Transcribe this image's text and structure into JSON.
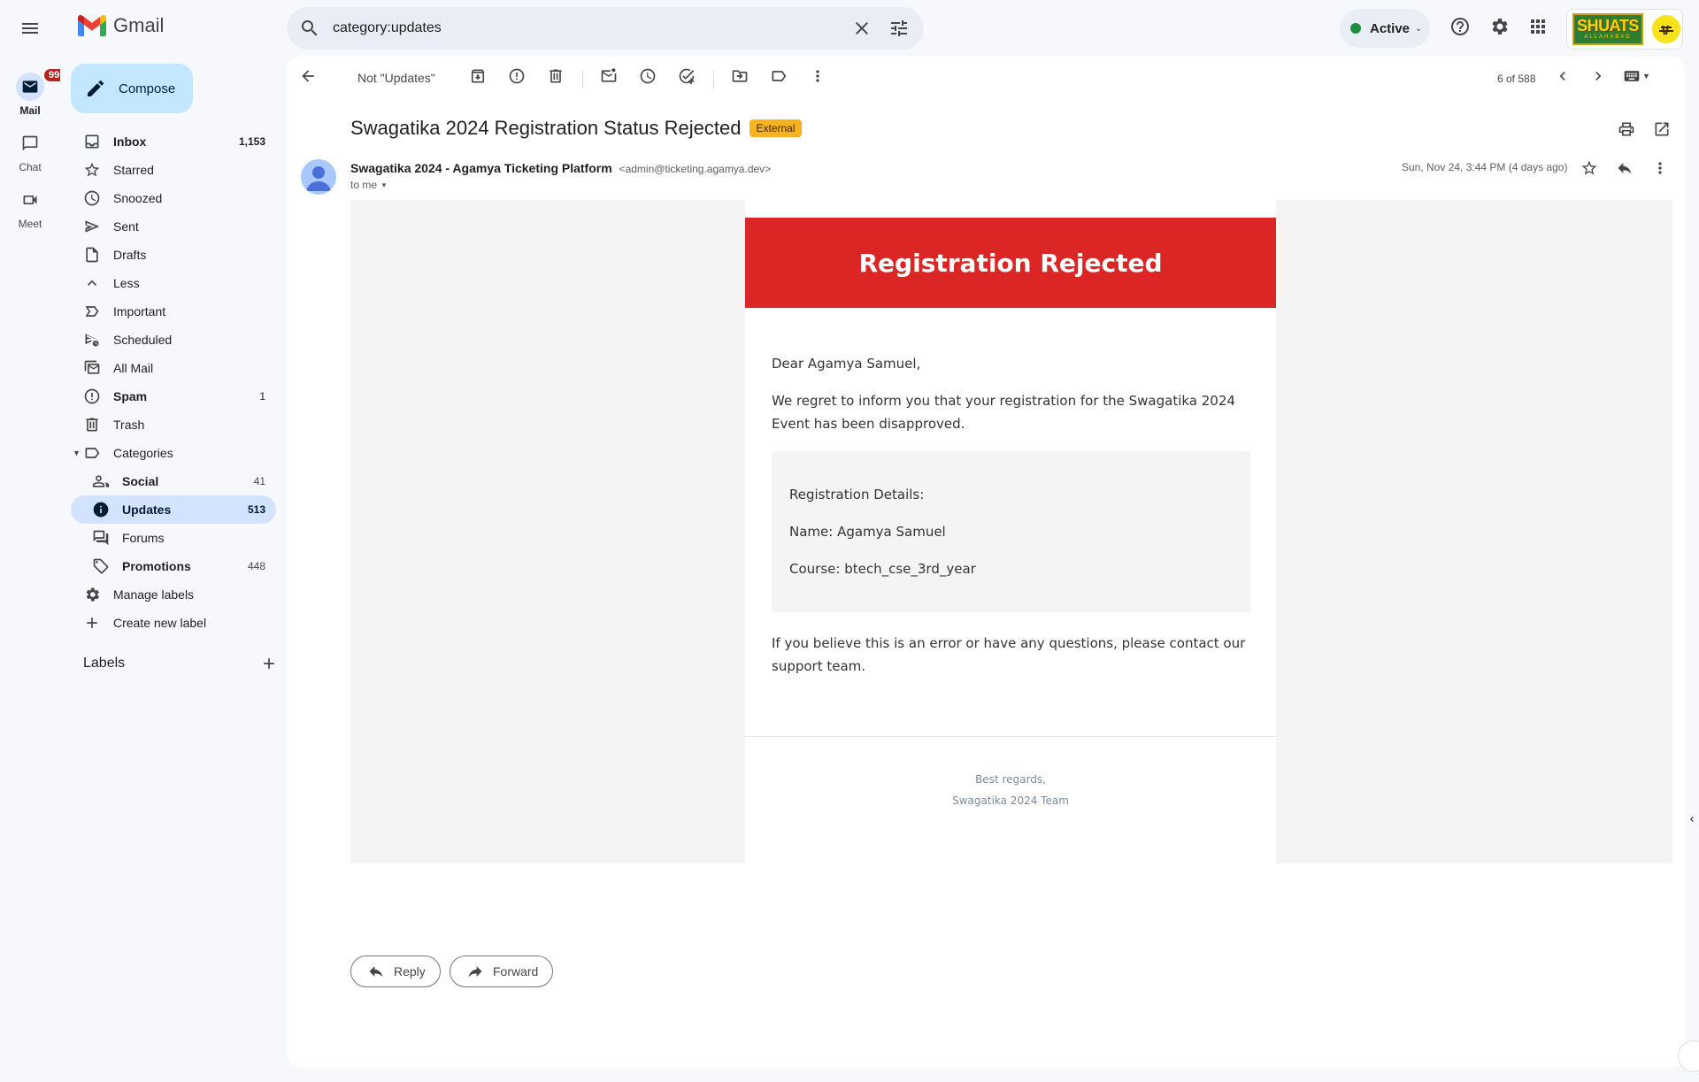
{
  "app": {
    "name": "Gmail"
  },
  "search": {
    "query": "category:updates"
  },
  "status": {
    "label": "Active",
    "color": "#1e8e3e"
  },
  "account": {
    "org_logo_text": "SHUATS",
    "org_logo_subtext": "ALLAHABAD"
  },
  "rail": {
    "items": [
      {
        "label": "Mail",
        "badge": "99+"
      },
      {
        "label": "Chat"
      },
      {
        "label": "Meet"
      }
    ]
  },
  "sidebar": {
    "compose_label": "Compose",
    "items": [
      {
        "label": "Inbox",
        "count": "1,153"
      },
      {
        "label": "Starred",
        "count": ""
      },
      {
        "label": "Snoozed",
        "count": ""
      },
      {
        "label": "Sent",
        "count": ""
      },
      {
        "label": "Drafts",
        "count": ""
      },
      {
        "label": "Less",
        "count": ""
      },
      {
        "label": "Important",
        "count": ""
      },
      {
        "label": "Scheduled",
        "count": ""
      },
      {
        "label": "All Mail",
        "count": ""
      },
      {
        "label": "Spam",
        "count": "1"
      },
      {
        "label": "Trash",
        "count": ""
      },
      {
        "label": "Categories",
        "count": ""
      }
    ],
    "categories": [
      {
        "label": "Social",
        "count": "41"
      },
      {
        "label": "Updates",
        "count": "513"
      },
      {
        "label": "Forums",
        "count": ""
      },
      {
        "label": "Promotions",
        "count": "448"
      }
    ],
    "manage_labels": "Manage labels",
    "create_label": "Create new label",
    "labels_heading": "Labels"
  },
  "toolbar": {
    "not_updates": "Not \"Updates\"",
    "pager": "6 of 588"
  },
  "message": {
    "subject": "Swagatika 2024 Registration Status Rejected",
    "external_badge": "External",
    "sender_name": "Swagatika 2024 - Agamya Ticketing Platform",
    "sender_email": "<admin@ticketing.agamya.dev>",
    "to": "to me",
    "date": "Sun, Nov 24, 3:44 PM (4 days ago)"
  },
  "email": {
    "banner": "Registration Rejected",
    "greeting": "Dear Agamya Samuel,",
    "paragraph1": "We regret to inform you that your registration for the Swagatika 2024 Event has been disapproved.",
    "details_heading": "Registration Details:",
    "details_name": "Name: Agamya Samuel",
    "details_course": "Course: btech_cse_3rd_year",
    "paragraph2": "If you believe this is an error or have any questions, please contact our support team.",
    "sign1": "Best regards,",
    "sign2": "Swagatika 2024 Team",
    "banner_color": "#dc2626"
  },
  "actions": {
    "reply": "Reply",
    "forward": "Forward"
  }
}
